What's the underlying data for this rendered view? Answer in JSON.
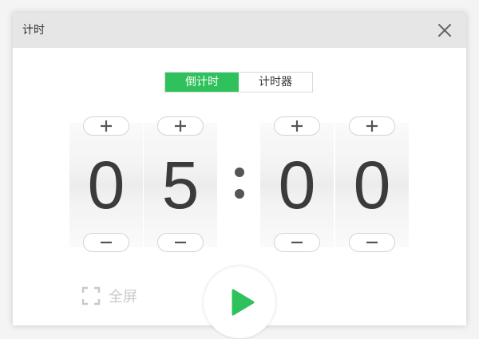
{
  "window": {
    "title": "计时"
  },
  "mode_switch": {
    "tabs": [
      {
        "label": "倒计时",
        "active": true
      },
      {
        "label": "计时器",
        "active": false
      }
    ]
  },
  "timer": {
    "digits": [
      "0",
      "5",
      "0",
      "0"
    ],
    "separator": ":"
  },
  "controls": {
    "fullscreen_label": "全屏",
    "play_icon": "play-icon"
  },
  "colors": {
    "accent": "#2ec15c",
    "digit": "#3b3b3b",
    "title_bar": "#e6e6e6",
    "muted": "#c9c9c9"
  }
}
